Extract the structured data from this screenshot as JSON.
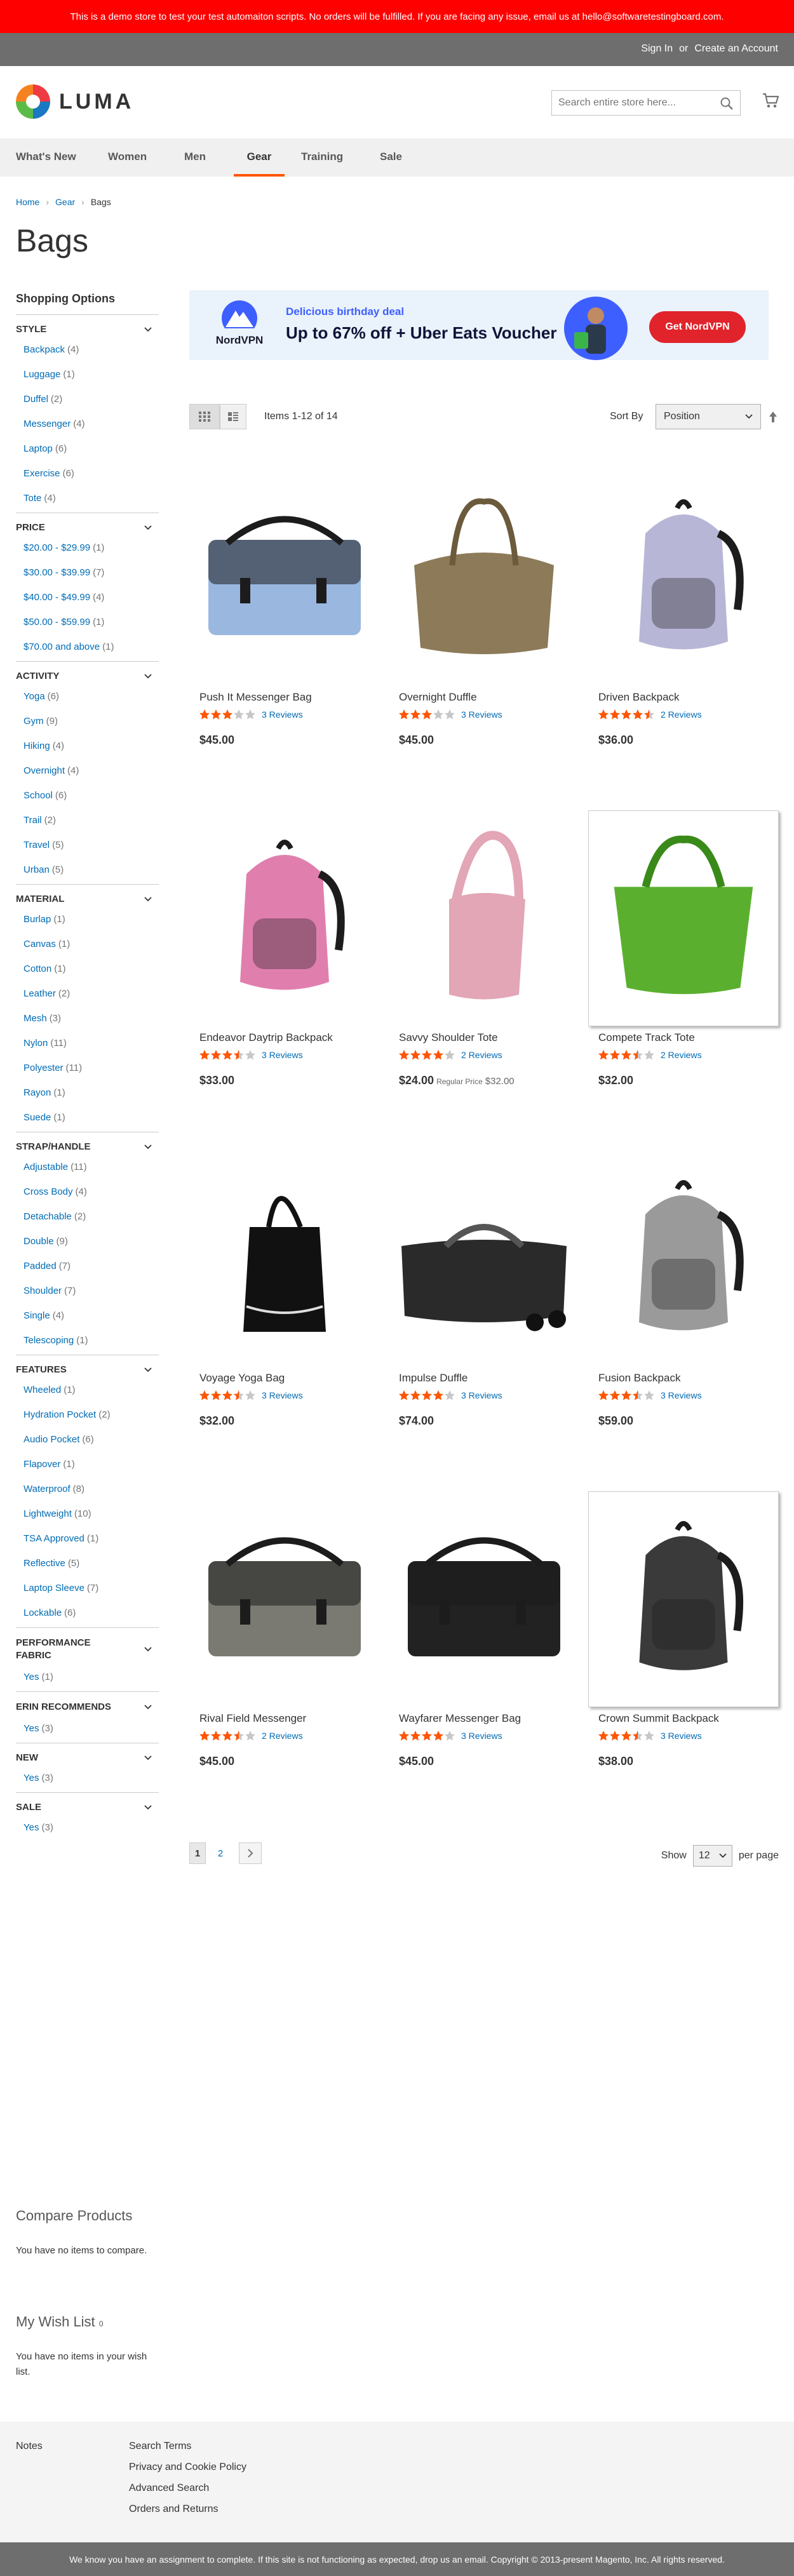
{
  "colors": {
    "accent": "#ff5501",
    "link": "#006bb4",
    "notice": "#ff0000",
    "star": "#ff5501"
  },
  "notice": {
    "text": "This is a demo store to test your test automaiton scripts. No orders will be fulfilled. If you are facing any issue, email us at hello@softwaretestingboard.com."
  },
  "header": {
    "sign_in": "Sign In",
    "or": "or",
    "create_account": "Create an Account",
    "logo": "LUMA",
    "search_placeholder": "Search entire store here..."
  },
  "nav": [
    {
      "label": "What's New"
    },
    {
      "label": "Women"
    },
    {
      "label": "Men"
    },
    {
      "label": "Gear",
      "active": true
    },
    {
      "label": "Training"
    },
    {
      "label": "Sale"
    }
  ],
  "breadcrumb": {
    "home": "Home",
    "gear": "Gear",
    "current": "Bags"
  },
  "page_title": "Bags",
  "sidebar": {
    "title": "Shopping Options",
    "filters": [
      {
        "name": "Style",
        "items": [
          [
            "Backpack",
            "4"
          ],
          [
            "Luggage",
            "1"
          ],
          [
            "Duffel",
            "2"
          ],
          [
            "Messenger",
            "4"
          ],
          [
            "Laptop",
            "6"
          ],
          [
            "Exercise",
            "6"
          ],
          [
            "Tote",
            "4"
          ]
        ]
      },
      {
        "name": "Price",
        "items": [
          [
            "$20.00 - $29.99",
            "1"
          ],
          [
            "$30.00 - $39.99",
            "7"
          ],
          [
            "$40.00 - $49.99",
            "4"
          ],
          [
            "$50.00 - $59.99",
            "1"
          ],
          [
            "$70.00 and above",
            "1"
          ]
        ]
      },
      {
        "name": "Activity",
        "items": [
          [
            "Yoga",
            "6"
          ],
          [
            "Gym",
            "9"
          ],
          [
            "Hiking",
            "4"
          ],
          [
            "Overnight",
            "4"
          ],
          [
            "School",
            "6"
          ],
          [
            "Trail",
            "2"
          ],
          [
            "Travel",
            "5"
          ],
          [
            "Urban",
            "5"
          ]
        ]
      },
      {
        "name": "Material",
        "items": [
          [
            "Burlap",
            "1"
          ],
          [
            "Canvas",
            "1"
          ],
          [
            "Cotton",
            "1"
          ],
          [
            "Leather",
            "2"
          ],
          [
            "Mesh",
            "3"
          ],
          [
            "Nylon",
            "11"
          ],
          [
            "Polyester",
            "11"
          ],
          [
            "Rayon",
            "1"
          ],
          [
            "Suede",
            "1"
          ]
        ]
      },
      {
        "name": "Strap/Handle",
        "items": [
          [
            "Adjustable",
            "11"
          ],
          [
            "Cross Body",
            "4"
          ],
          [
            "Detachable",
            "2"
          ],
          [
            "Double",
            "9"
          ],
          [
            "Padded",
            "7"
          ],
          [
            "Shoulder",
            "7"
          ],
          [
            "Single",
            "4"
          ],
          [
            "Telescoping",
            "1"
          ]
        ]
      },
      {
        "name": "Features",
        "items": [
          [
            "Wheeled",
            "1"
          ],
          [
            "Hydration Pocket",
            "2"
          ],
          [
            "Audio Pocket",
            "6"
          ],
          [
            "Flapover",
            "1"
          ],
          [
            "Waterproof",
            "8"
          ],
          [
            "Lightweight",
            "10"
          ],
          [
            "TSA Approved",
            "1"
          ],
          [
            "Reflective",
            "5"
          ],
          [
            "Laptop Sleeve",
            "7"
          ],
          [
            "Lockable",
            "6"
          ]
        ]
      },
      {
        "name": "Performance Fabric",
        "items": [
          [
            "Yes",
            "1"
          ]
        ]
      },
      {
        "name": "Erin Recommends",
        "items": [
          [
            "Yes",
            "3"
          ]
        ]
      },
      {
        "name": "New",
        "items": [
          [
            "Yes",
            "3"
          ]
        ]
      },
      {
        "name": "Sale",
        "items": [
          [
            "Yes",
            "3"
          ]
        ]
      }
    ],
    "compare_title": "Compare Products",
    "compare_text": "You have no items to compare.",
    "wish_title": "My Wish List",
    "wish_count": "0",
    "wish_text": "You have no items in your wish list."
  },
  "banner": {
    "brand": "NordVPN",
    "deal": "Delicious birthday deal",
    "headline": "Up to 67% off + Uber Eats Voucher",
    "cta": "Get NordVPN"
  },
  "toolbar": {
    "amount": "Items 1-12 of 14",
    "sort_label": "Sort By",
    "sort_value": "Position"
  },
  "products": [
    {
      "name": "Push It Messenger Bag",
      "rating": 3,
      "reviews": "3 Reviews",
      "price": "$45.00",
      "icon": "messenger-bag-icon",
      "color": "#9ab7e0",
      "shape": "messenger"
    },
    {
      "name": "Overnight Duffle",
      "rating": 3,
      "reviews": "3 Reviews",
      "price": "$45.00",
      "icon": "duffle-bag-icon",
      "color": "#8c7a58",
      "shape": "duffle"
    },
    {
      "name": "Driven Backpack",
      "rating": 4.5,
      "reviews": "2 Reviews",
      "price": "$36.00",
      "icon": "backpack-icon",
      "color": "#b7b6d6",
      "shape": "backpack"
    },
    {
      "name": "Endeavor Daytrip Backpack",
      "rating": 3.5,
      "reviews": "3 Reviews",
      "price": "$33.00",
      "icon": "backpack-icon",
      "color": "#e07fae",
      "shape": "backpack"
    },
    {
      "name": "Savvy Shoulder Tote",
      "rating": 4,
      "reviews": "2 Reviews",
      "price": "$24.00",
      "regular_label": "Regular Price",
      "regular_price": "$32.00",
      "icon": "tote-bag-icon",
      "color": "#e2a6b6",
      "shape": "shoulder"
    },
    {
      "name": "Compete Track Tote",
      "rating": 3.5,
      "reviews": "2 Reviews",
      "price": "$32.00",
      "icon": "tote-bag-icon",
      "color": "#5ab02e",
      "shape": "tote",
      "hover": true
    },
    {
      "name": "Voyage Yoga Bag",
      "rating": 3.5,
      "reviews": "3 Reviews",
      "price": "$32.00",
      "icon": "tote-bag-icon",
      "color": "#111111",
      "shape": "yoga"
    },
    {
      "name": "Impulse Duffle",
      "rating": 4,
      "reviews": "3 Reviews",
      "price": "$74.00",
      "icon": "duffle-bag-icon",
      "color": "#2a2a2a",
      "shape": "rolling"
    },
    {
      "name": "Fusion Backpack",
      "rating": 3.5,
      "reviews": "3 Reviews",
      "price": "$59.00",
      "icon": "backpack-icon",
      "color": "#9a9a9a",
      "shape": "backpack"
    },
    {
      "name": "Rival Field Messenger",
      "rating": 3.5,
      "reviews": "2 Reviews",
      "price": "$45.00",
      "icon": "messenger-bag-icon",
      "color": "#7a7a72",
      "shape": "messenger"
    },
    {
      "name": "Wayfarer Messenger Bag",
      "rating": 4,
      "reviews": "3 Reviews",
      "price": "$45.00",
      "icon": "messenger-bag-icon",
      "color": "#222222",
      "shape": "messenger"
    },
    {
      "name": "Crown Summit Backpack",
      "rating": 3.5,
      "reviews": "3 Reviews",
      "price": "$38.00",
      "icon": "backpack-icon",
      "color": "#3a3a3a",
      "shape": "backpack",
      "hover": true
    }
  ],
  "pager": {
    "current": "1",
    "page2": "2",
    "show_label": "Show",
    "limit": "12",
    "per_page": "per page"
  },
  "footer": {
    "notes": "Notes",
    "links": [
      "Search Terms",
      "Privacy and Cookie Policy",
      "Advanced Search",
      "Orders and Returns"
    ]
  },
  "copyright": "We know you have an assignment to complete. If this site is not functioning as expected, drop us an email. Copyright © 2013-present Magento, Inc. All rights reserved."
}
